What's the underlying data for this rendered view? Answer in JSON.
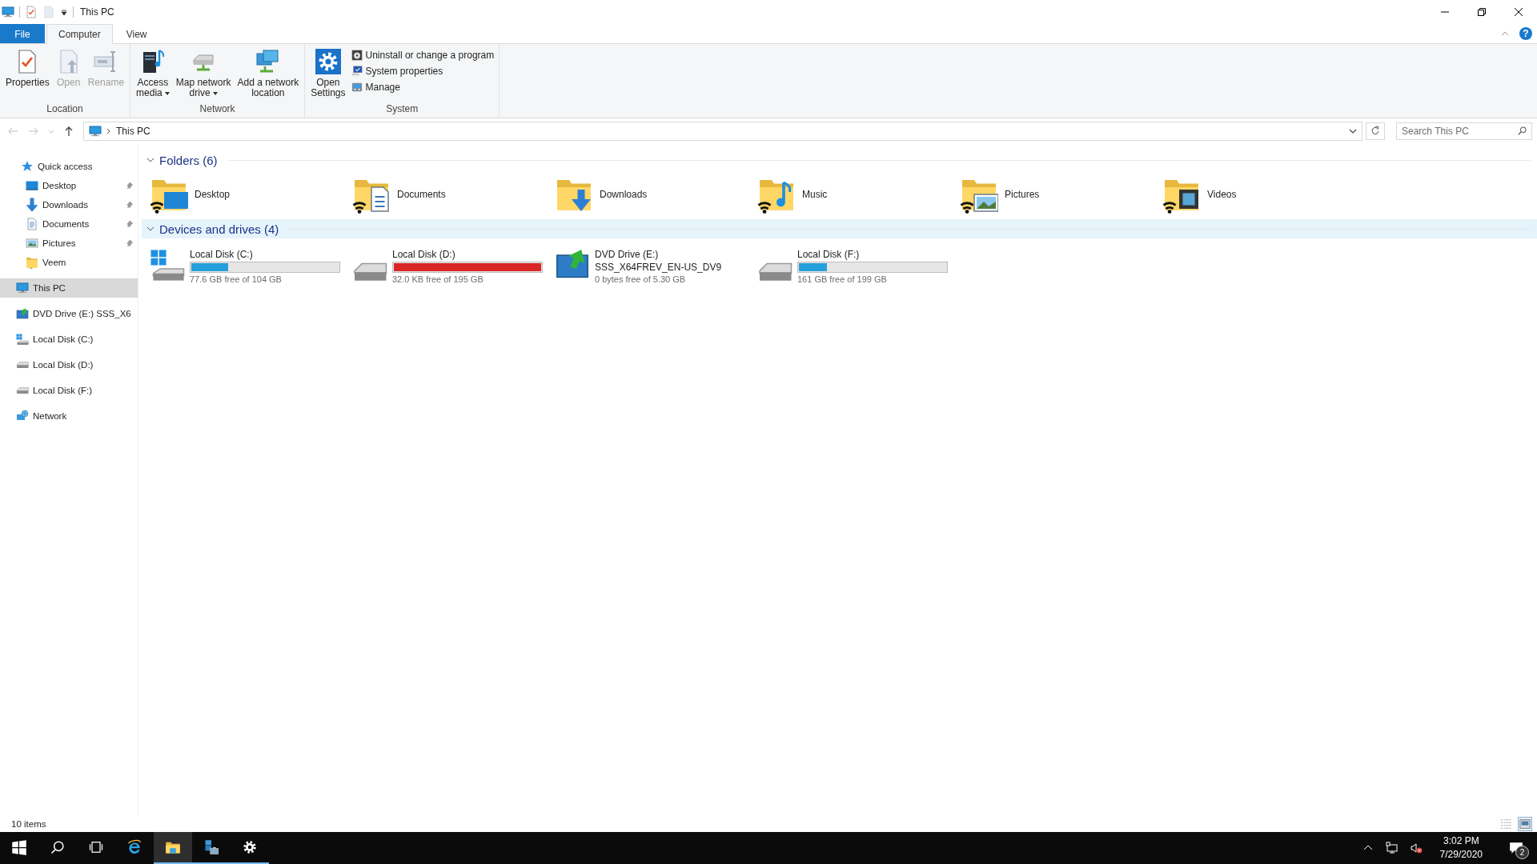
{
  "window": {
    "title": "This PC"
  },
  "ribbon": {
    "tabs": [
      {
        "label": "File",
        "kind": "file",
        "selected": false
      },
      {
        "label": "Computer",
        "kind": "tab",
        "selected": true
      },
      {
        "label": "View",
        "kind": "tab",
        "selected": false
      }
    ],
    "help": "?",
    "groups": [
      {
        "label": "Location",
        "buttons": [
          {
            "lines": [
              "Properties"
            ],
            "kind": "properties",
            "disabled": false,
            "dropdown": false
          },
          {
            "lines": [
              "Open"
            ],
            "kind": "open",
            "disabled": true,
            "dropdown": false
          },
          {
            "lines": [
              "Rename"
            ],
            "kind": "rename",
            "disabled": true,
            "dropdown": false
          }
        ]
      },
      {
        "label": "Network",
        "buttons": [
          {
            "lines": [
              "Access",
              "media"
            ],
            "kind": "media",
            "disabled": false,
            "dropdown": true
          },
          {
            "lines": [
              "Map network",
              "drive"
            ],
            "kind": "mapdrive",
            "disabled": false,
            "dropdown": true
          },
          {
            "lines": [
              "Add a network",
              "location"
            ],
            "kind": "addlocation",
            "disabled": false,
            "dropdown": false
          }
        ]
      },
      {
        "label": "System",
        "buttons": [
          {
            "lines": [
              "Open",
              "Settings"
            ],
            "kind": "settings",
            "disabled": false,
            "dropdown": false
          }
        ],
        "small_buttons": [
          {
            "label": "Uninstall or change a program",
            "kind": "uninstall"
          },
          {
            "label": "System properties",
            "kind": "sysproperties"
          },
          {
            "label": "Manage",
            "kind": "manage"
          }
        ]
      }
    ]
  },
  "address": {
    "path": "This PC",
    "search_placeholder": "Search This PC"
  },
  "navigation": [
    {
      "label": "Quick access",
      "kind": "quickaccess",
      "selected": false,
      "children": [
        {
          "label": "Desktop",
          "kind": "desktop",
          "pinned": true,
          "selected": false
        },
        {
          "label": "Downloads",
          "kind": "downloads",
          "pinned": true,
          "selected": false
        },
        {
          "label": "Documents",
          "kind": "documents",
          "pinned": true,
          "selected": false
        },
        {
          "label": "Pictures",
          "kind": "pictures",
          "pinned": true,
          "selected": false
        },
        {
          "label": "Veem",
          "kind": "folder",
          "pinned": false,
          "selected": false
        }
      ]
    },
    {
      "label": "This PC",
      "kind": "pc",
      "selected": true
    },
    {
      "label": "DVD Drive (E:) SSS_X6",
      "kind": "optical",
      "selected": false
    },
    {
      "label": "Local Disk (C:)",
      "kind": "system",
      "selected": false
    },
    {
      "label": "Local Disk (D:)",
      "kind": "disk",
      "selected": false
    },
    {
      "label": "Local Disk (F:)",
      "kind": "disk",
      "selected": false
    },
    {
      "label": "Network",
      "kind": "network",
      "selected": false
    }
  ],
  "sections": [
    {
      "title": "Folders (6)",
      "kind": "folders",
      "expanded": true,
      "highlighted": false,
      "items": [
        {
          "label": "Desktop",
          "kind": "desktop"
        },
        {
          "label": "Documents",
          "kind": "documents"
        },
        {
          "label": "Downloads",
          "kind": "downloads"
        },
        {
          "label": "Music",
          "kind": "music"
        },
        {
          "label": "Pictures",
          "kind": "pictures"
        },
        {
          "label": "Videos",
          "kind": "videos"
        }
      ]
    },
    {
      "title": "Devices and drives (4)",
      "kind": "drives",
      "expanded": true,
      "highlighted": true,
      "items": [
        {
          "kind": "system",
          "label": "Local Disk (C:)",
          "level": 0.25,
          "low_space": false,
          "free": "77.6 GB free of 104 GB"
        },
        {
          "kind": "disk",
          "label": "Local Disk (D:)",
          "level": 1.0,
          "low_space": true,
          "free": "32.0 KB free of 195 GB"
        },
        {
          "kind": "optical",
          "label": "DVD Drive (E:)",
          "sublabel": "SSS_X64FREV_EN-US_DV9",
          "free": "0 bytes free of 5.30 GB"
        },
        {
          "kind": "disk",
          "label": "Local Disk (F:)",
          "level": 0.19,
          "low_space": false,
          "free": "161 GB free of 199 GB"
        }
      ]
    }
  ],
  "status_bar": {
    "count": "10 items",
    "views": [
      {
        "kind": "details",
        "selected": false
      },
      {
        "kind": "large",
        "selected": true
      }
    ]
  },
  "taskbar": {
    "apps": [
      {
        "kind": "start",
        "running": false,
        "selected": false
      },
      {
        "kind": "search",
        "running": false,
        "selected": false
      },
      {
        "kind": "taskview",
        "running": false,
        "selected": false
      },
      {
        "kind": "ie",
        "running": false,
        "selected": false
      },
      {
        "kind": "explorer",
        "running": true,
        "selected": true
      },
      {
        "kind": "server",
        "running": true,
        "selected": false
      },
      {
        "kind": "gear",
        "running": true,
        "selected": false
      }
    ],
    "tray": [
      {
        "kind": "chevron"
      },
      {
        "kind": "network"
      },
      {
        "kind": "mute"
      }
    ],
    "time": "3:02 PM",
    "date": "7/29/2020",
    "notifications": "2"
  }
}
